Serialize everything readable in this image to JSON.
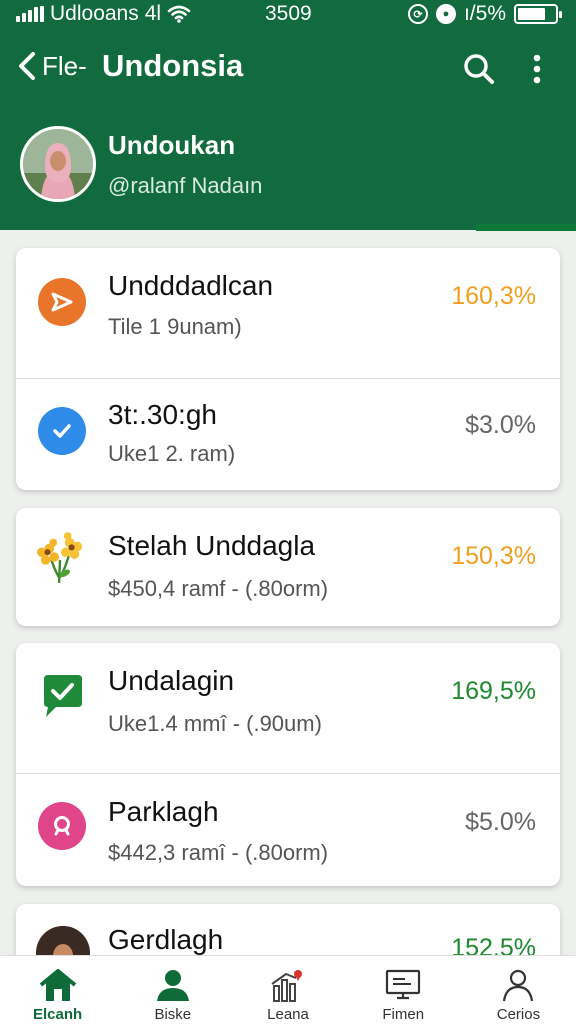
{
  "status_bar": {
    "carrier": "Udlooans",
    "network": "4l",
    "time": "3509",
    "battery_percent": "ı/5%",
    "battery_level": 0.75
  },
  "toolbar": {
    "back_label": "Fle-",
    "title": "Undonsia",
    "icons": [
      "chevron-left-icon",
      "search-icon",
      "more-vertical-icon"
    ]
  },
  "profile": {
    "name": "Undoukan",
    "handle": "@ralanf Nadaın"
  },
  "colors": {
    "header": "#116b3e",
    "accent": "#0d7a3a",
    "orange_value": "#f0a020",
    "green_value": "#1c8a2e",
    "gray_value": "#666666"
  },
  "cards": [
    {
      "rows": [
        {
          "title": "Undddadlcan",
          "subtitle": "Tile 1 9unam)",
          "value": "160,3%",
          "value_color": "#f0a020",
          "icon": "send-icon",
          "icon_bg": "#e8752a"
        },
        {
          "title": "3t:.30:gh",
          "subtitle": "Uke1 2. ram)",
          "value": "$3.0%",
          "value_color": "#666666",
          "icon": "check-circle-icon",
          "icon_bg": "#2e8be8"
        }
      ]
    },
    {
      "rows": [
        {
          "title": "Stelah Unddagla",
          "subtitle": "$450,4 ramf - (.80orm)",
          "value": "150,3%",
          "value_color": "#f0a020",
          "icon": "flowers-icon",
          "icon_bg": ""
        }
      ]
    },
    {
      "rows": [
        {
          "title": "Undalagin",
          "subtitle": "Uke1.4 mmî - (.90um)",
          "value": "169,5%",
          "value_color": "#1c8a2e",
          "icon": "chat-check-icon",
          "icon_bg": "#1e8a3a"
        },
        {
          "title": "Parklagh",
          "subtitle": "$442,3 ramî - (.80orm)",
          "value": "$5.0%",
          "value_color": "#666666",
          "icon": "search-circle-icon",
          "icon_bg": "#e0458a"
        }
      ]
    },
    {
      "rows": [
        {
          "title": "Gerdlagh",
          "subtitle": "",
          "value": "152,5%",
          "value_color": "#1c8a2e",
          "icon": "avatar-icon",
          "icon_bg": "#6b4a3a"
        }
      ]
    }
  ],
  "tabs": [
    {
      "label": "Elcanh",
      "icon": "home-icon",
      "active": true
    },
    {
      "label": "Biske",
      "icon": "person-icon",
      "active": false
    },
    {
      "label": "Leana",
      "icon": "chart-pin-icon",
      "active": false
    },
    {
      "label": "Fimen",
      "icon": "screen-icon",
      "active": false
    },
    {
      "label": "Cerios",
      "icon": "user-outline-icon",
      "active": false
    }
  ]
}
